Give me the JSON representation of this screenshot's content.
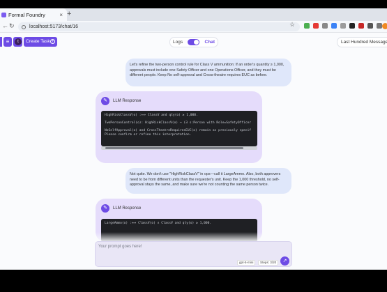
{
  "browser": {
    "tab_title": "Formal Foundry",
    "tab_close": "×",
    "new_tab": "+",
    "url": "localhost:5173/chat/16",
    "back": "←",
    "reload": "↻",
    "star": "☆"
  },
  "toolbar": {
    "menu_glyph": "≡",
    "avatar_initial": "t",
    "create_task_label": "Create Task",
    "create_task_plus": "+",
    "logs_label": "Logs",
    "chat_label": "Chat",
    "last_messages_label": "Last Hundred Messages"
  },
  "chat": {
    "messages": [
      {
        "role": "user",
        "text": "Let's refine the two-person control rule for Class V ammunition: If an order's quantity ≥ 1,000, approvals must include one Safety Officer and one Operations Officer, and they must be different people. Keep No self-approval and Cross-theatre requires EUC as before."
      },
      {
        "role": "llm",
        "header": "LLM Response",
        "icon": "✎",
        "code": "HighRiskClassV(o) :⟺ ClassV and qty(o) ≥ 1,000.\n\nTwoPersonControl(o): HighRiskClassV(o) → (∃ s:Person with Role=SafetyOfficer\n\nNoSelfApproval(o) and CrossTheatreRequiresEUC(o) remain as previously specif\nPlease confirm or refine this interpretation."
      },
      {
        "role": "user",
        "text": "Not quite. We don't use \"HighRiskClassV\" in ops—call it LargeAmmo. Also, both approvers need to be from different units than the requester's unit. Keep the 1,000 threshold, no self-approval stays the same, and make sure we're not counting the same person twice."
      },
      {
        "role": "llm",
        "header": "LLM Response",
        "icon": "✎",
        "code": "LargeAmmo(o) :⟺ ClassV(o) ∧ ClassV and qty(o) ≥ 1,000."
      }
    ]
  },
  "prompt": {
    "placeholder": "Your prompt goes here!",
    "model": "gpt-5-mini",
    "steps": "Steps: 3/20",
    "send_glyph": "↗"
  }
}
